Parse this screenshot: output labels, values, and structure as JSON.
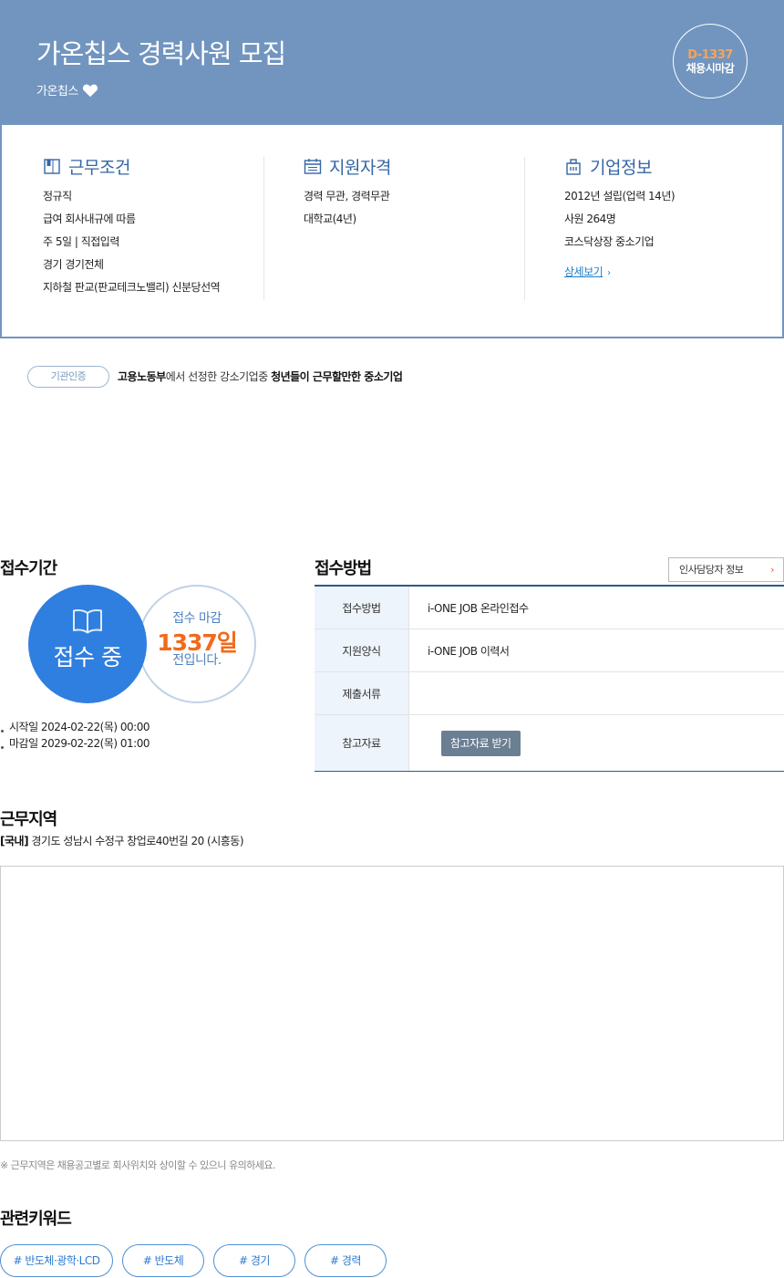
{
  "header": {
    "title": "가온칩스 경력사원 모집",
    "company": "가온칩스",
    "dday": "D-1337",
    "dday_status": "채용시마감"
  },
  "conditions": {
    "title": "근무조건",
    "items": [
      "정규직",
      "급여 회사내규에 따름",
      "주 5일 | 직접입력",
      "경기 경기전체",
      "지하철 판교(판교테크노밸리) 신분당선역"
    ]
  },
  "qualifications": {
    "title": "지원자격",
    "items": [
      "경력 무관, 경력무관",
      "대학교(4년)"
    ]
  },
  "company_info": {
    "title": "기업정보",
    "items": [
      "2012년 설립(업력 14년)",
      "사원 264명",
      "코스닥상장 중소기업"
    ],
    "more_label": "상세보기"
  },
  "certification": {
    "badge": "기관인증",
    "org": "고용노동부",
    "text": "에서 선정한 강소기업중 ",
    "highlight": "청년들이 근무할만한 중소기업"
  },
  "period": {
    "title": "접수기간",
    "status": "접수 중",
    "deadline_label": "접수 마감",
    "days_left": "1337일",
    "days_suffix": "전입니다.",
    "start": "시작일 2024-02-22(목) 00:00",
    "end": "마감일 2029-02-22(목) 01:00"
  },
  "method": {
    "title": "접수방법",
    "hr_button": "인사담당자 정보",
    "rows": [
      {
        "label": "접수방법",
        "value": "i-ONE JOB 온라인접수"
      },
      {
        "label": "지원양식",
        "value": "i-ONE JOB 이력서"
      },
      {
        "label": "제출서류",
        "value": ""
      },
      {
        "label": "참고자료",
        "value": ""
      }
    ],
    "ref_button": "참고자료 받기"
  },
  "location": {
    "title": "근무지역",
    "tag": "[국내]",
    "address": " 경기도 성남시 수정구 창업로40번길 20 (시흥동)",
    "notice": "※ 근무지역은 채용공고별로 회사위치와 상이할 수 있으니 유의하세요."
  },
  "keywords": {
    "title": "관련키워드",
    "items": [
      "# 반도체·광학·LCD",
      "# 반도체",
      "# 경기",
      "# 경력"
    ]
  },
  "colors": {
    "header_bg": "#7195bf",
    "accent_blue": "#2f7fe0",
    "accent_orange": "#f26a1b"
  }
}
